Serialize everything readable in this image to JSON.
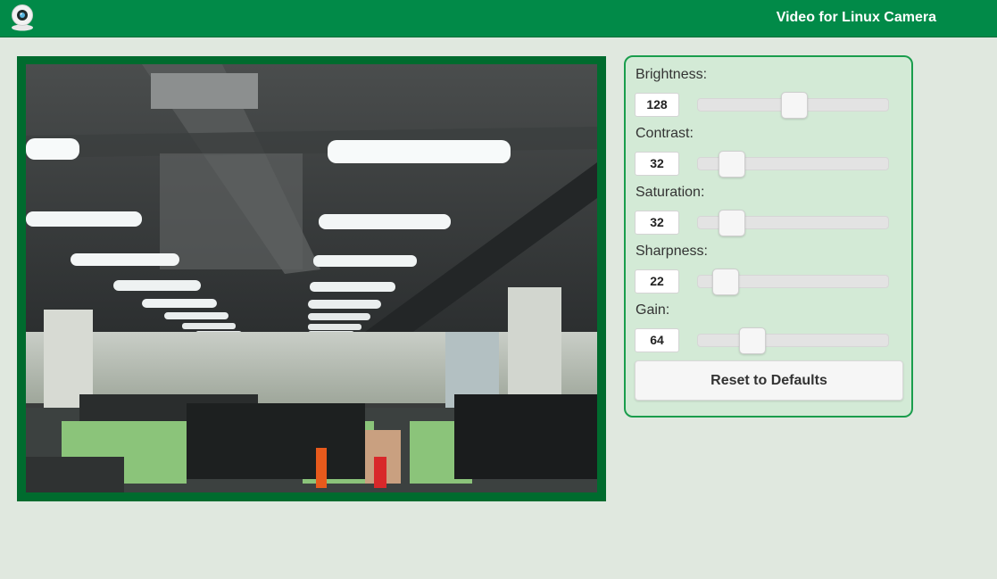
{
  "header": {
    "title": "Video for Linux Camera",
    "app_icon": "webcam-icon",
    "bar_color": "#018a48"
  },
  "video": {
    "frame_color": "#006b2e",
    "description_icon": "camera-feed"
  },
  "controls": [
    {
      "id": "brightness",
      "label": "Brightness:",
      "value": "128",
      "min": 0,
      "max": 255,
      "position": 0.5
    },
    {
      "id": "contrast",
      "label": "Contrast:",
      "value": "32",
      "min": 0,
      "max": 255,
      "position": 0.125
    },
    {
      "id": "saturation",
      "label": "Saturation:",
      "value": "32",
      "min": 0,
      "max": 255,
      "position": 0.125
    },
    {
      "id": "sharpness",
      "label": "Sharpness:",
      "value": "22",
      "min": 0,
      "max": 255,
      "position": 0.086
    },
    {
      "id": "gain",
      "label": "Gain:",
      "value": "64",
      "min": 0,
      "max": 255,
      "position": 0.25
    }
  ],
  "reset_button": {
    "label": "Reset to Defaults"
  },
  "colors": {
    "panel_bg": "#d3ead6",
    "panel_border": "#1a9d4c",
    "page_bg": "#e0e8df"
  }
}
